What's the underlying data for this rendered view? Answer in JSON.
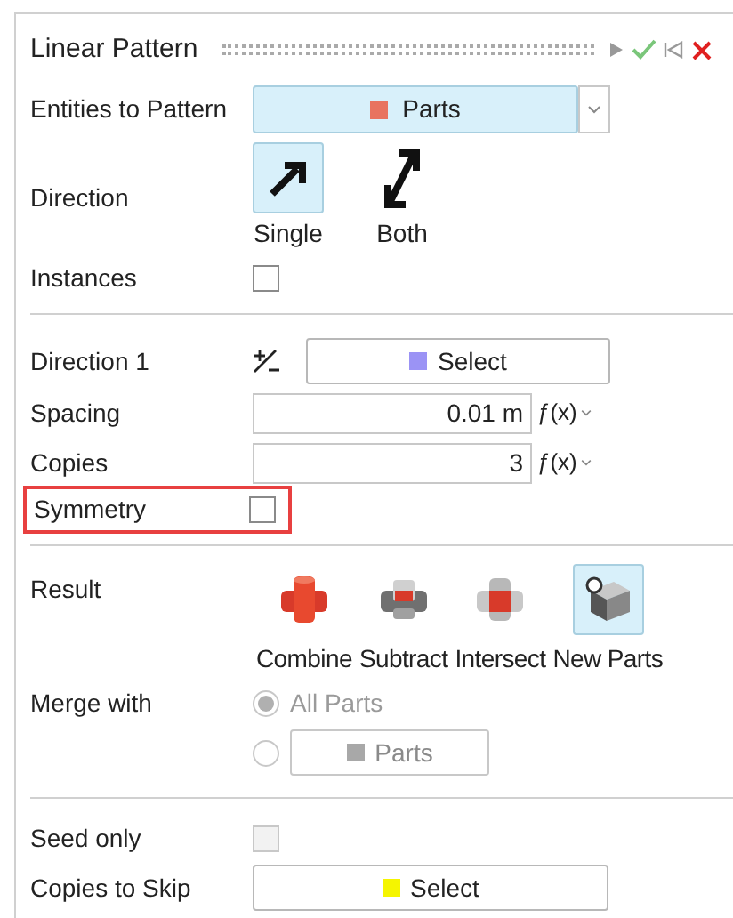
{
  "panel": {
    "title": "Linear Pattern"
  },
  "entities": {
    "label": "Entities to Pattern",
    "value": "Parts",
    "color": "#e8735f"
  },
  "direction": {
    "label": "Direction",
    "options": [
      {
        "label": "Single",
        "kind": "single",
        "selected": true
      },
      {
        "label": "Both",
        "kind": "both",
        "selected": false
      }
    ]
  },
  "instances": {
    "label": "Instances",
    "checked": false
  },
  "direction1": {
    "label": "Direction 1",
    "value": "Select",
    "color": "#9b93f5"
  },
  "spacing": {
    "label": "Spacing",
    "value": "0.01 m",
    "fx": "ƒ(x)"
  },
  "copies": {
    "label": "Copies",
    "value": "3",
    "fx": "ƒ(x)"
  },
  "symmetry": {
    "label": "Symmetry",
    "checked": false,
    "highlighted": true
  },
  "result": {
    "label": "Result",
    "options": [
      {
        "label": "Combine",
        "kind": "combine",
        "selected": false
      },
      {
        "label": "Subtract",
        "kind": "subtract",
        "selected": false
      },
      {
        "label": "Intersect",
        "kind": "intersect",
        "selected": false
      },
      {
        "label": "New Parts",
        "kind": "new",
        "selected": true
      }
    ]
  },
  "merge": {
    "label": "Merge with",
    "disabled": true,
    "options": [
      {
        "kind": "text",
        "label": "All Parts",
        "selected": true
      },
      {
        "kind": "selector",
        "value": "Parts",
        "color": "#a8a8a8",
        "selected": false
      }
    ]
  },
  "seed_only": {
    "label": "Seed only",
    "checked": false,
    "disabled": true
  },
  "copies_to_skip": {
    "label": "Copies to Skip",
    "value": "Select",
    "color": "#f5f500"
  }
}
